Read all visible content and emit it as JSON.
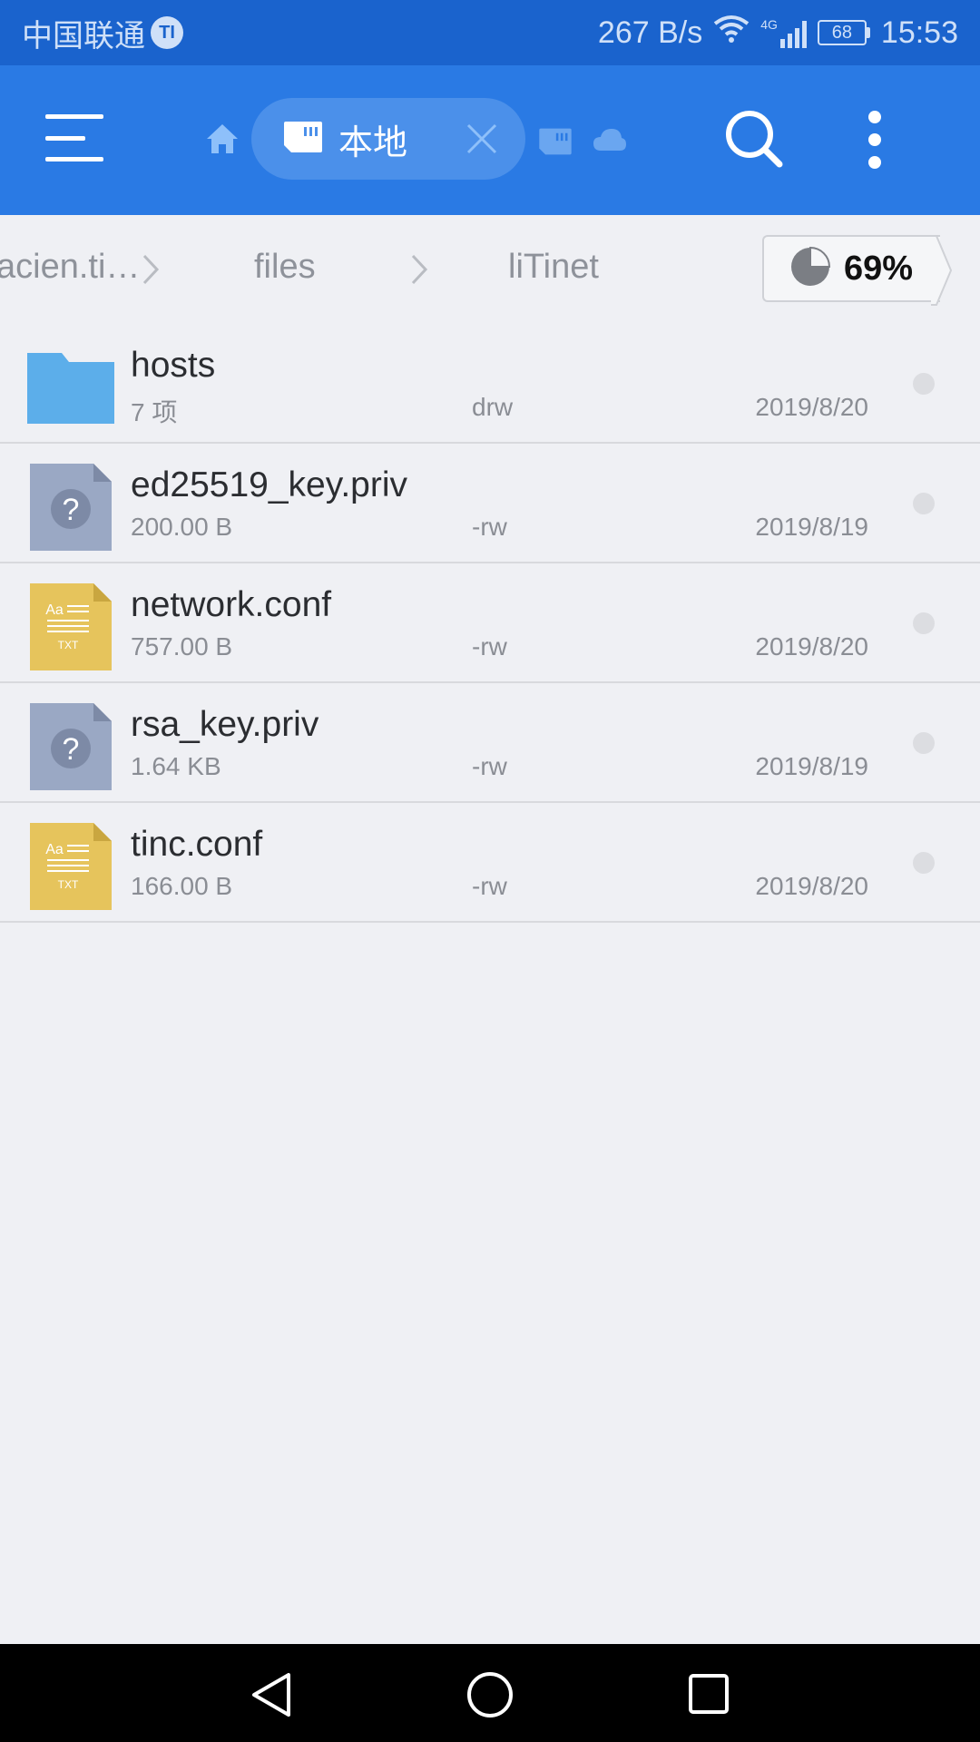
{
  "status_bar": {
    "carrier": "中国联通",
    "carrier_badge": "TI",
    "net_speed": "267 B/s",
    "network_type": "4G",
    "battery": "68",
    "time": "15:53"
  },
  "toolbar": {
    "active_tab_label": "本地",
    "icons": [
      "menu-icon",
      "home-icon",
      "sd-card-icon",
      "close-icon",
      "sd-card-icon",
      "cloud-icon",
      "search-icon",
      "more-vert-icon"
    ]
  },
  "breadcrumb": {
    "items": [
      "acien.ti…",
      "files",
      "liTinet"
    ],
    "storage_percent": "69%"
  },
  "files": [
    {
      "name": "hosts",
      "size": "7 项",
      "perm": "drw",
      "date": "2019/8/20",
      "type": "folder"
    },
    {
      "name": "ed25519_key.priv",
      "size": "200.00 B",
      "perm": "-rw",
      "date": "2019/8/19",
      "type": "unknown"
    },
    {
      "name": "network.conf",
      "size": "757.00 B",
      "perm": "-rw",
      "date": "2019/8/20",
      "type": "txt"
    },
    {
      "name": "rsa_key.priv",
      "size": "1.64 KB",
      "perm": "-rw",
      "date": "2019/8/19",
      "type": "unknown"
    },
    {
      "name": "tinc.conf",
      "size": "166.00 B",
      "perm": "-rw",
      "date": "2019/8/20",
      "type": "txt"
    }
  ],
  "icon_text": {
    "unknown_glyph": "?",
    "txt_aa": "Aa",
    "txt_label": "TXT"
  },
  "colors": {
    "status_bar": "#1a63cd",
    "toolbar": "#2a7ae4",
    "tab_pill": "#4b90ea",
    "folder": "#5caeea",
    "txt_file": "#e6c45c",
    "unknown_file": "#9aa8c4",
    "background": "#eff0f4"
  }
}
